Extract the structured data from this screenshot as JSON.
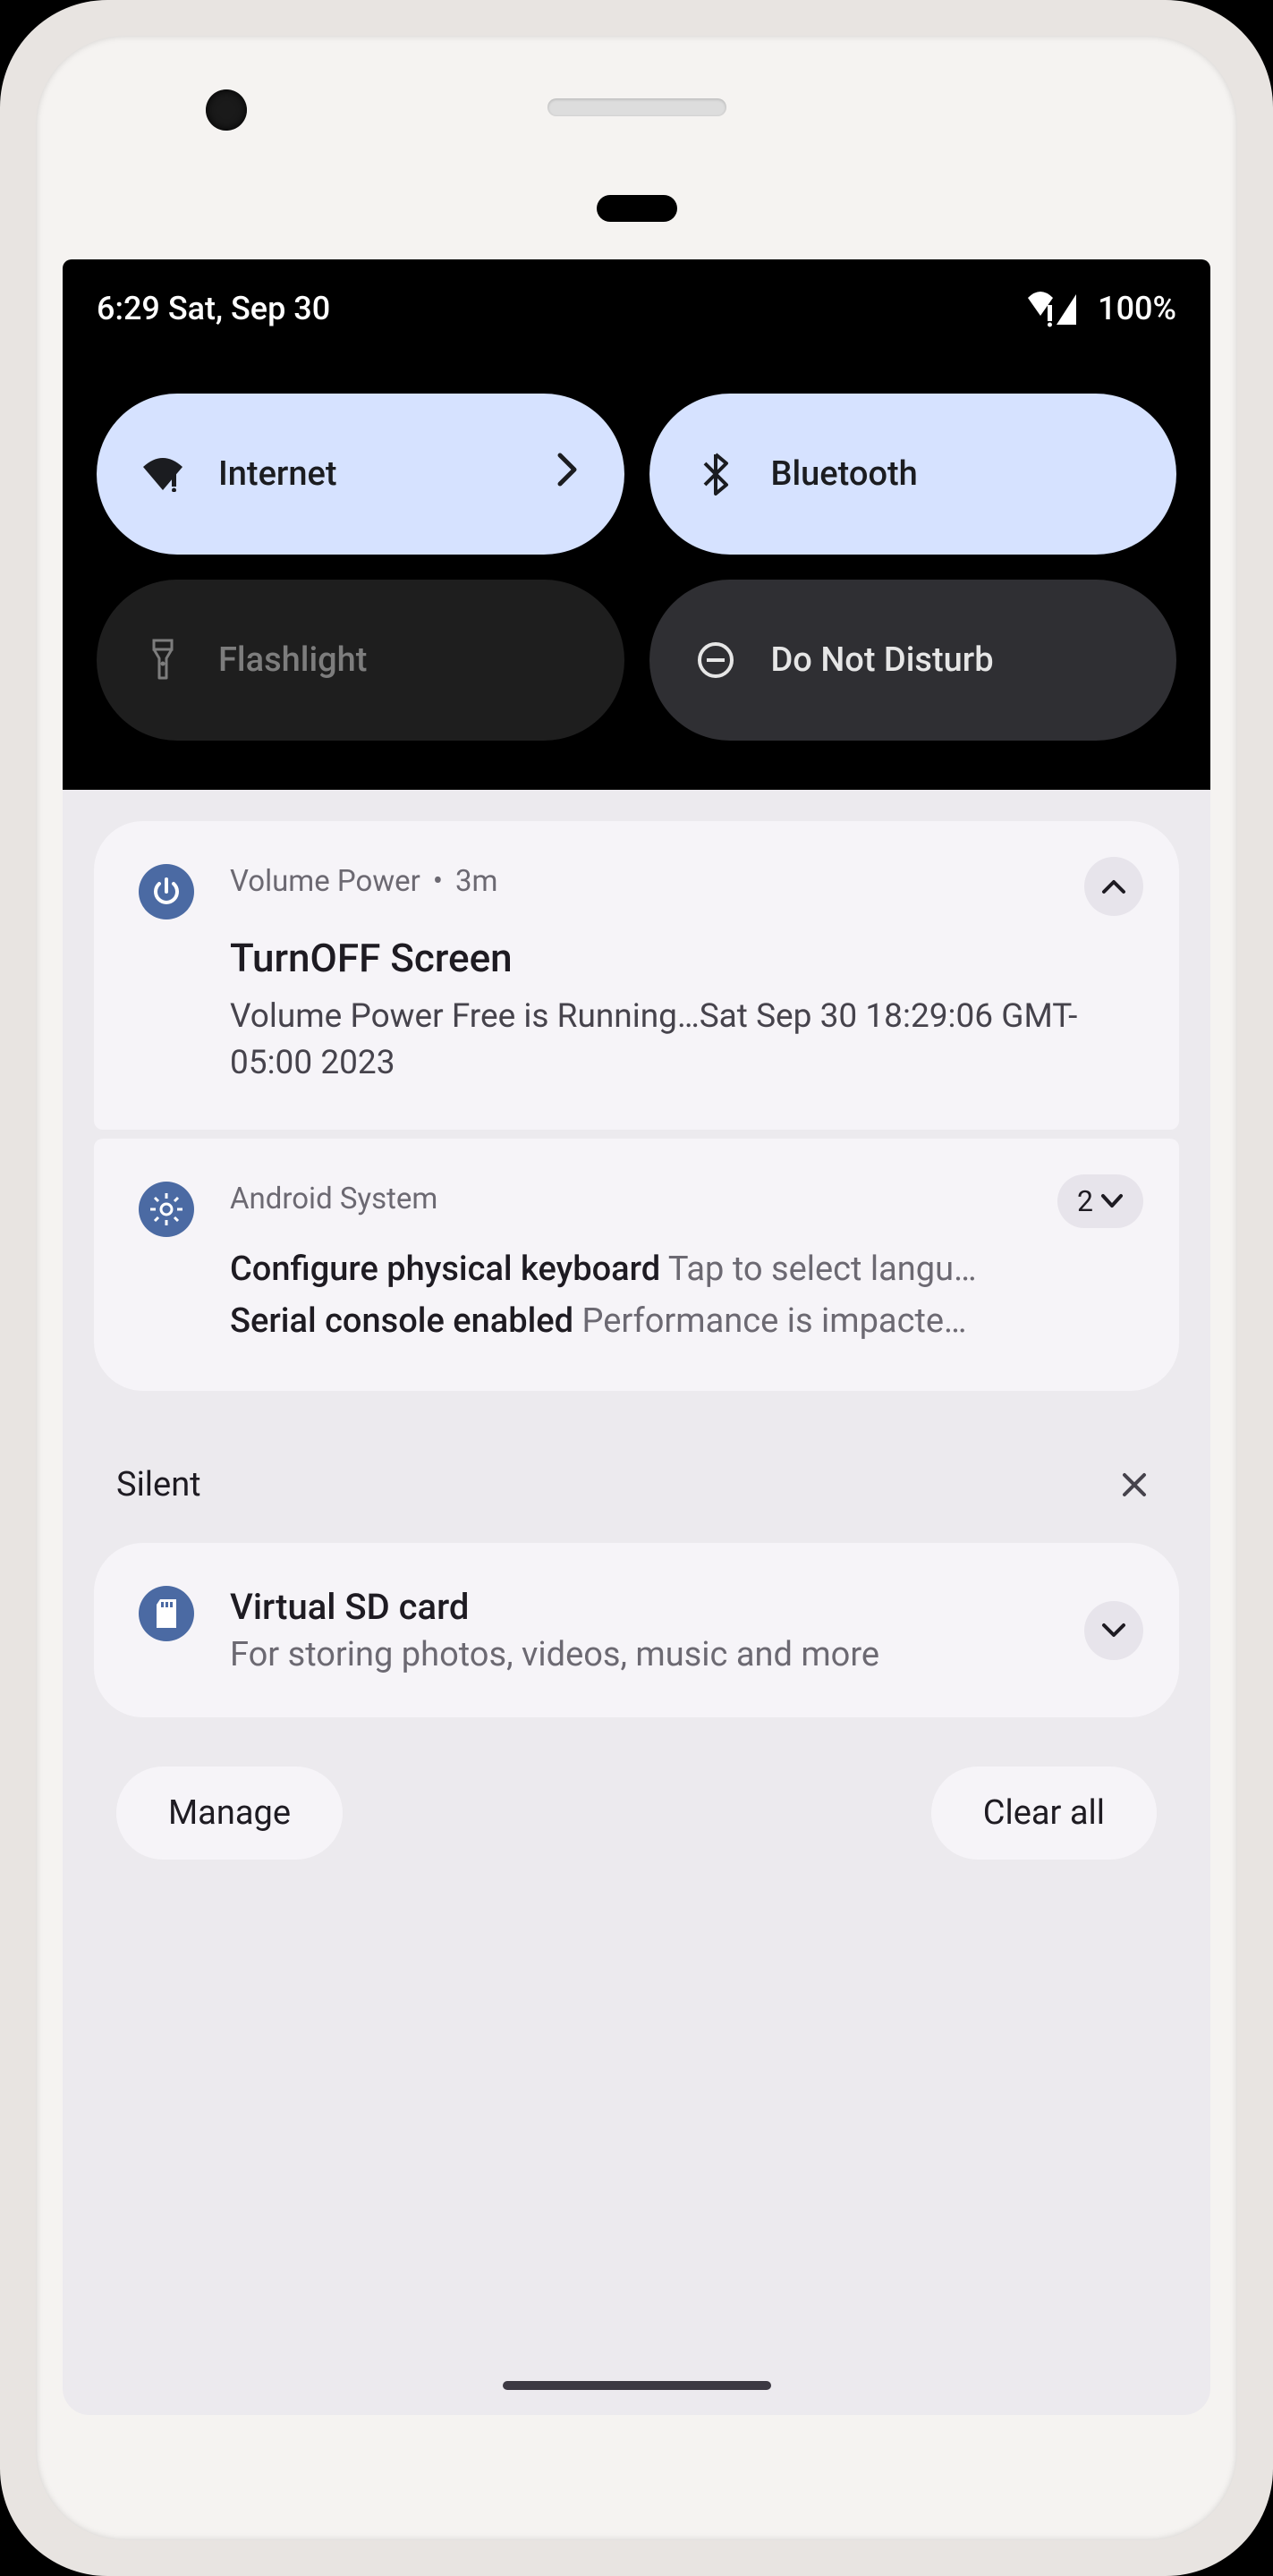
{
  "status": {
    "time_date": "6:29 Sat, Sep 30",
    "battery": "100%"
  },
  "quick_settings": {
    "internet": "Internet",
    "bluetooth": "Bluetooth",
    "flashlight": "Flashlight",
    "dnd": "Do Not Disturb"
  },
  "notifications": {
    "vp": {
      "app": "Volume Power",
      "dot": "•",
      "age": "3m",
      "title": "TurnOFF Screen",
      "body": "Volume Power Free is Running…Sat Sep 30 18:29:06 GMT-05:00 2023"
    },
    "system": {
      "app": "Android System",
      "count": "2",
      "l1_title": "Configure physical keyboard",
      "l1_body": "Tap to select langu…",
      "l2_title": "Serial console enabled",
      "l2_body": "Performance is impacte…"
    },
    "silent_label": "Silent",
    "sd": {
      "title": "Virtual SD card",
      "body": "For storing photos, videos, music and more"
    }
  },
  "footer": {
    "manage": "Manage",
    "clear_all": "Clear all"
  }
}
